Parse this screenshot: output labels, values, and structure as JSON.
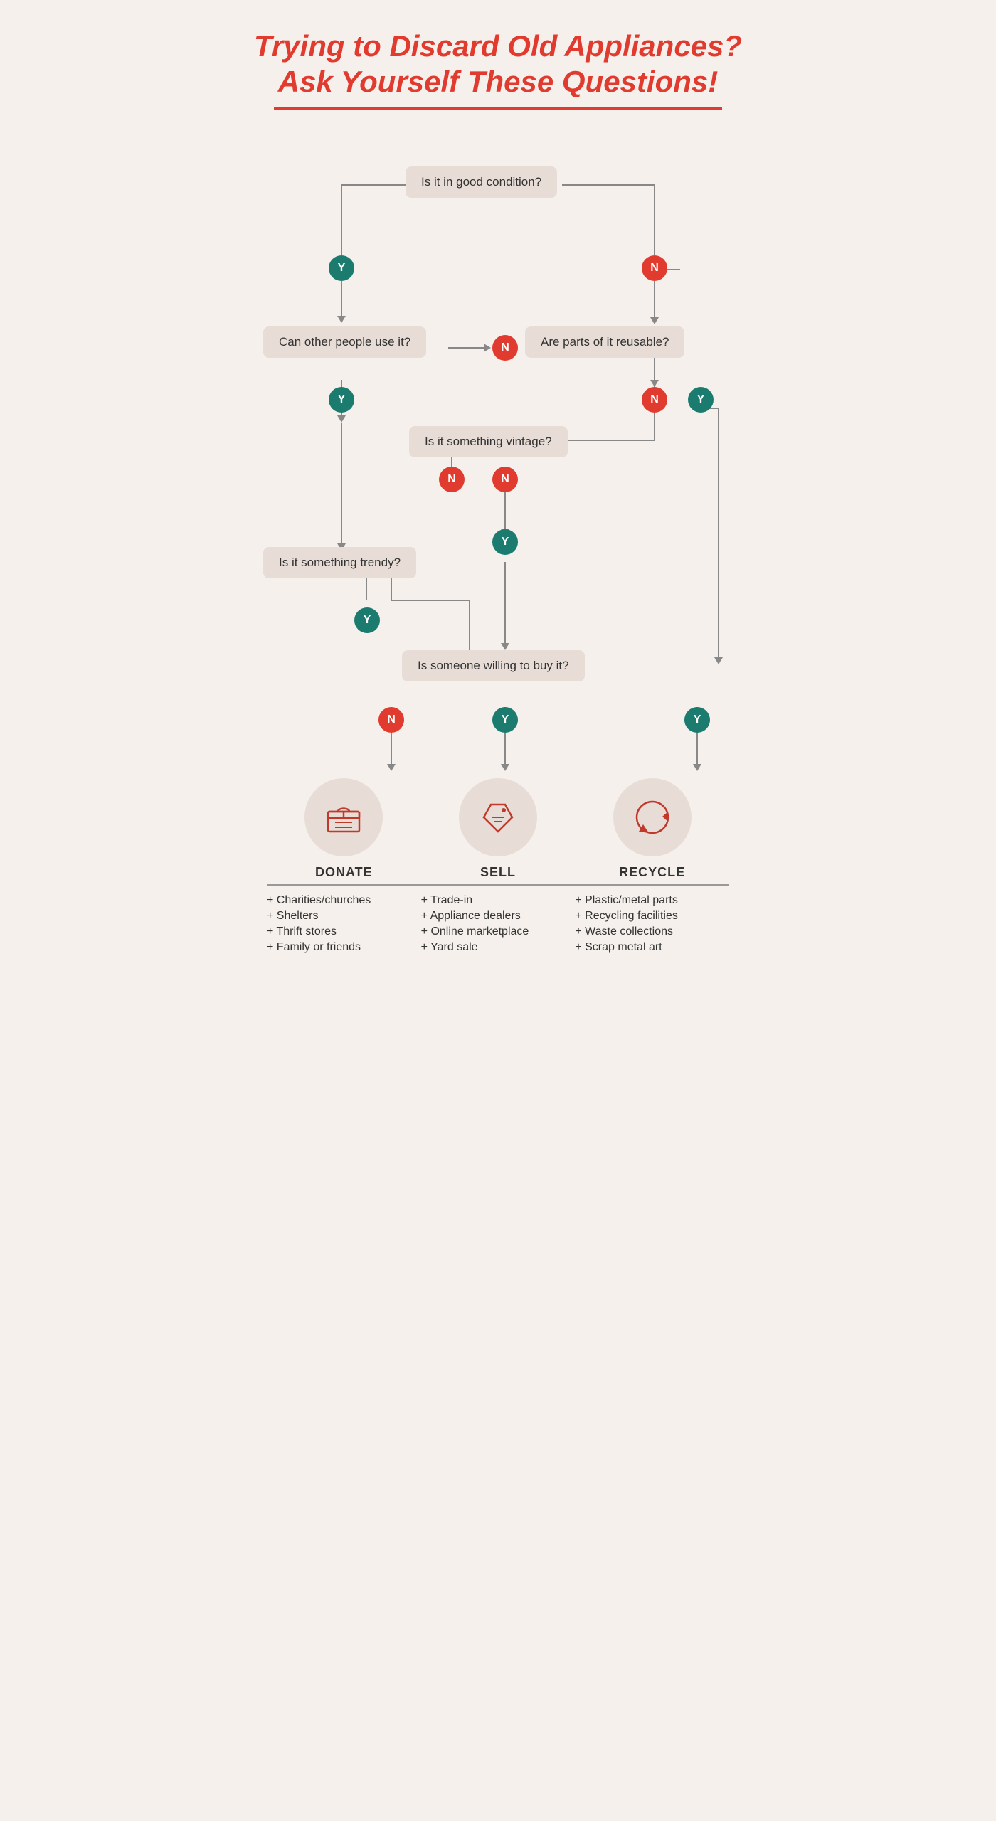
{
  "title": {
    "line1": "Trying to Discard Old Appliances?",
    "line2": "Ask Yourself These Questions!"
  },
  "questions": {
    "q1": "Is it in good condition?",
    "q2_left": "Can other people use it?",
    "q2_right": "Are parts of it reusable?",
    "q3": "Is it something vintage?",
    "q4": "Is it something trendy?",
    "q5": "Is someone willing to buy it?"
  },
  "badges": {
    "yes": "Y",
    "no": "N"
  },
  "categories": {
    "donate": {
      "title": "DONATE",
      "items": [
        "+ Charities/churches",
        "+ Shelters",
        "+ Thrift stores",
        "+ Family or friends"
      ]
    },
    "sell": {
      "title": "SELL",
      "items": [
        "+ Trade-in",
        "+ Appliance dealers",
        "+ Online marketplace",
        "+ Yard sale"
      ]
    },
    "recycle": {
      "title": "RECYCLE",
      "items": [
        "+ Plastic/metal parts",
        "+ Recycling facilities",
        "+ Waste collections",
        "+ Scrap metal art"
      ]
    }
  }
}
